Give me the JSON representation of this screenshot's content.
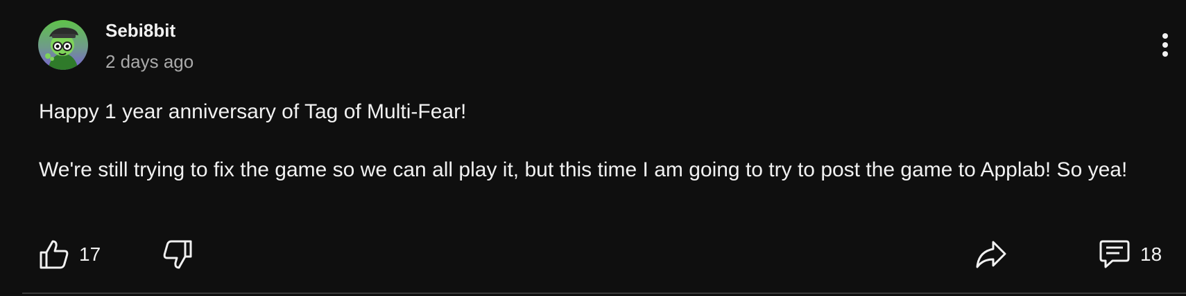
{
  "post": {
    "author": "Sebi8bit",
    "timestamp": "2 days ago",
    "body": [
      "Happy 1 year anniversary of Tag of Multi-Fear!",
      "We're still trying to fix the game so we can all play it, but this time I am going to try to post the game to Applab! So yea!"
    ]
  },
  "actions": {
    "like_count": "17",
    "comment_count": "18"
  },
  "icons": {
    "menu": "vertical-dots-icon",
    "like": "thumbs-up-icon",
    "dislike": "thumbs-down-icon",
    "share": "share-arrow-icon",
    "comments": "comment-bubble-icon"
  },
  "colors": {
    "background": "#0f0f0f",
    "primary_text": "#f1f1f1",
    "secondary_text": "#aaaaaa",
    "avatar_gradient_top": "#5fc24a",
    "avatar_gradient_bottom": "#7a5fd6"
  }
}
